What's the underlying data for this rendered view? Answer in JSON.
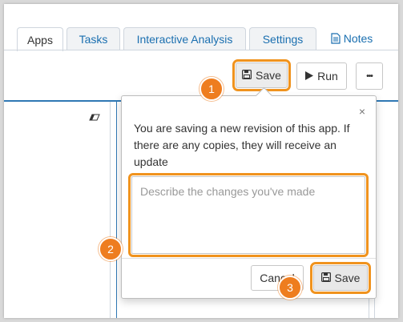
{
  "tabs": [
    {
      "label": "Apps",
      "active": true
    },
    {
      "label": "Tasks"
    },
    {
      "label": "Interactive Analysis"
    },
    {
      "label": "Settings"
    },
    {
      "label": "Notes",
      "icon": "document-icon"
    }
  ],
  "toolbar": {
    "save_label": "Save",
    "run_label": "Run",
    "more_label": "•••"
  },
  "popover": {
    "message": "You are saving a new revision of this app. If there are any copies, they will receive an update",
    "close_symbol": "×",
    "textarea_placeholder": "Describe the changes you've made",
    "cancel_label": "Cancel",
    "save_label": "Save"
  },
  "badges": [
    "1",
    "2",
    "3"
  ],
  "colors": {
    "highlight": "#f0931e",
    "badge": "#ee7d1f",
    "tab_link": "#1a6fb0",
    "editor_line": "#2f78b4"
  }
}
